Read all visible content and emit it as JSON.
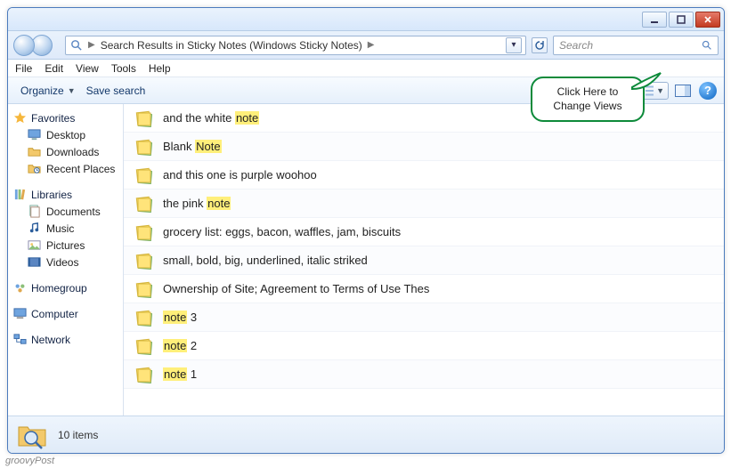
{
  "window_controls": {
    "minimize": "min",
    "maximize": "max",
    "close": "close"
  },
  "breadcrumb": {
    "text": "Search Results in Sticky Notes (Windows Sticky Notes)",
    "sep": "▶"
  },
  "search": {
    "placeholder": "Search",
    "value": ""
  },
  "menubar": [
    "File",
    "Edit",
    "View",
    "Tools",
    "Help"
  ],
  "toolbar": {
    "organize": "Organize",
    "save_search": "Save search",
    "help_glyph": "?"
  },
  "callout": "Click Here to Change Views",
  "highlight_patterns": [
    "note",
    "Note"
  ],
  "sidebar": {
    "favorites": {
      "label": "Favorites",
      "items": [
        {
          "label": "Desktop",
          "icon": "desktop-icon"
        },
        {
          "label": "Downloads",
          "icon": "downloads-icon"
        },
        {
          "label": "Recent Places",
          "icon": "recent-icon"
        }
      ]
    },
    "libraries": {
      "label": "Libraries",
      "items": [
        {
          "label": "Documents",
          "icon": "documents-icon"
        },
        {
          "label": "Music",
          "icon": "music-icon"
        },
        {
          "label": "Pictures",
          "icon": "pictures-icon"
        },
        {
          "label": "Videos",
          "icon": "videos-icon"
        }
      ]
    },
    "homegroup": {
      "label": "Homegroup"
    },
    "computer": {
      "label": "Computer"
    },
    "network": {
      "label": "Network"
    }
  },
  "results": [
    {
      "title": "and the white note"
    },
    {
      "title": "Blank Note"
    },
    {
      "title": "and this one is purple woohoo"
    },
    {
      "title": "the pink note"
    },
    {
      "title": "grocery list: eggs, bacon, waffles, jam, biscuits"
    },
    {
      "title": "small, bold,  big,  underlined, italic striked"
    },
    {
      "title": "Ownership of Site; Agreement to Terms of Use Thes"
    },
    {
      "title": "note 3"
    },
    {
      "title": "note 2"
    },
    {
      "title": "note 1"
    }
  ],
  "status": {
    "count_label": "10 items"
  },
  "watermark": "groovyPost"
}
